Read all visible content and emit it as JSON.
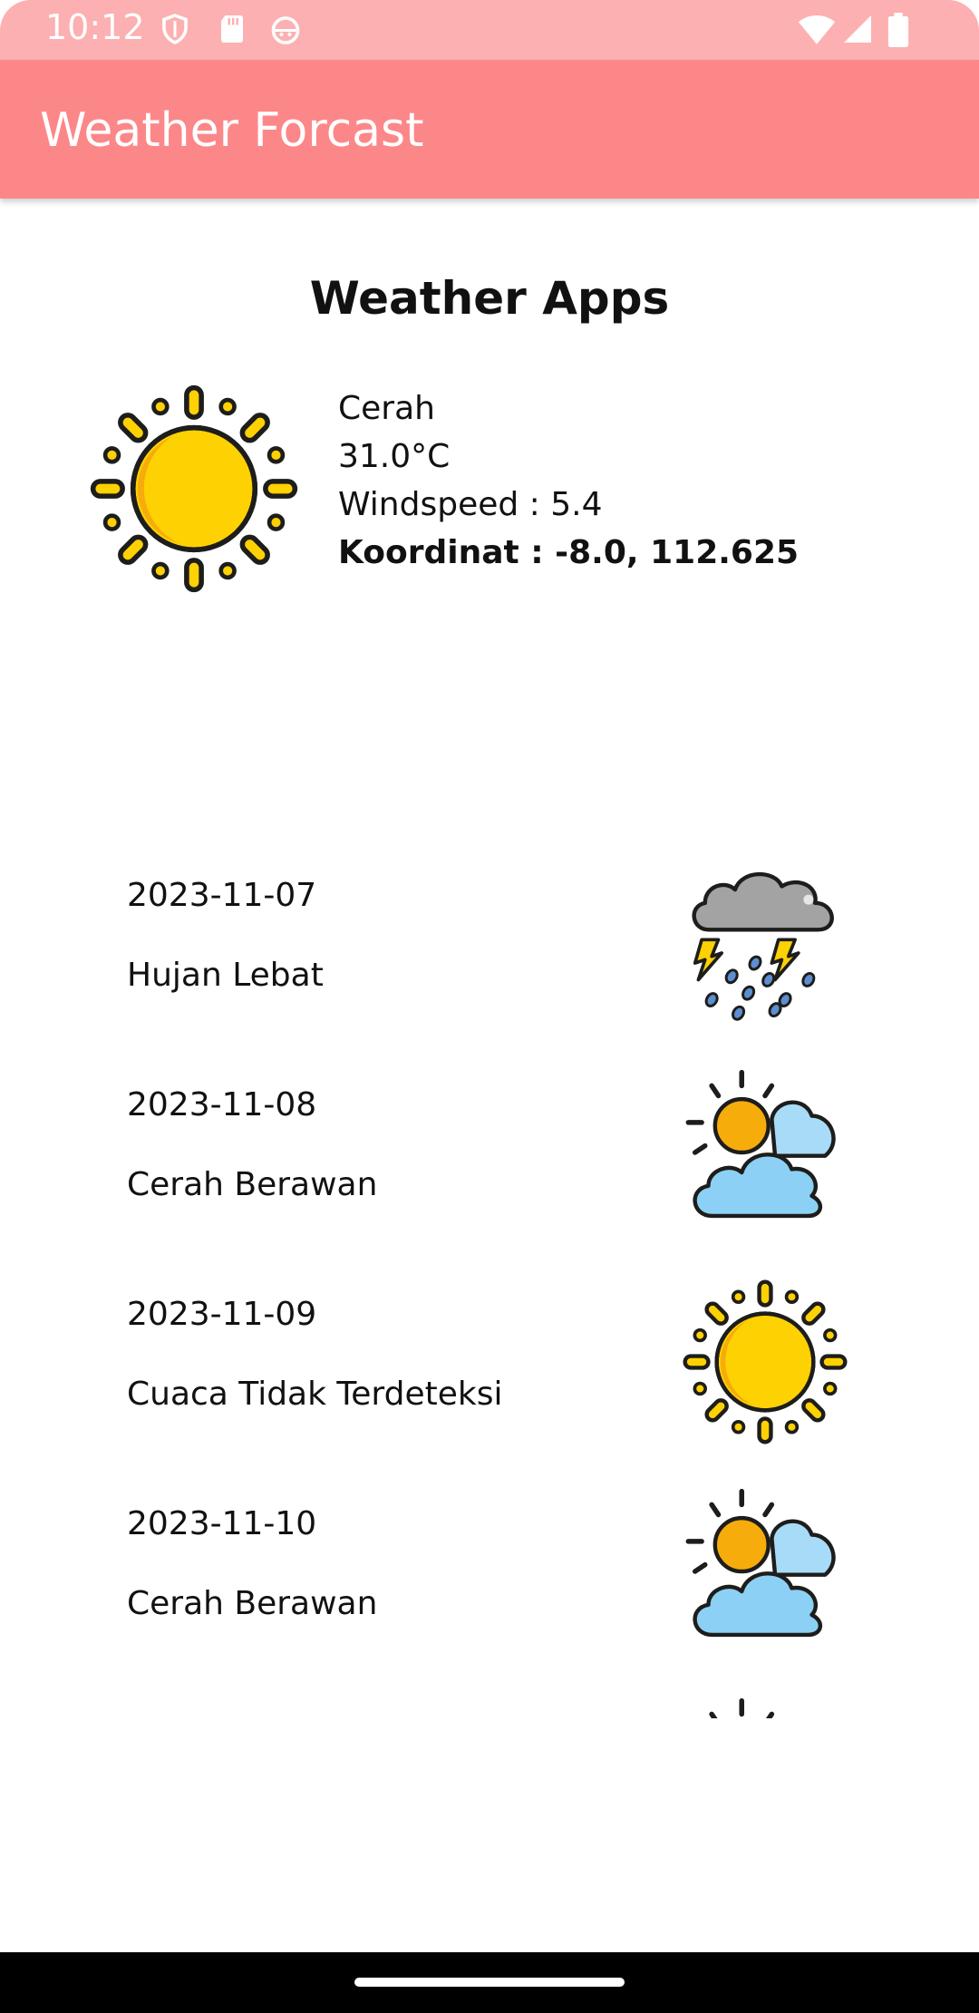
{
  "status_bar": {
    "time": "10:12",
    "icons": [
      "shield-icon",
      "sd-card-icon",
      "android-face-icon",
      "wifi-icon",
      "signal-icon",
      "battery-icon"
    ]
  },
  "app_bar": {
    "title": "Weather Forcast"
  },
  "main": {
    "heading": "Weather Apps",
    "current": {
      "icon": "sun-icon",
      "condition": "Cerah",
      "temperature": "31.0°C",
      "windspeed": "Windspeed : 5.4",
      "coordinates": "Koordinat : -8.0, 112.625"
    },
    "forecast": [
      {
        "date": "2023-11-07",
        "description": "Hujan Lebat",
        "icon": "thunderstorm-icon"
      },
      {
        "date": "2023-11-08",
        "description": "Cerah Berawan",
        "icon": "partly-cloudy-icon"
      },
      {
        "date": "2023-11-09",
        "description": "Cuaca Tidak Terdeteksi",
        "icon": "sun-icon"
      },
      {
        "date": "2023-11-10",
        "description": "Cerah Berawan",
        "icon": "partly-cloudy-icon"
      },
      {
        "date": "",
        "description": "",
        "icon": "partly-cloudy-icon"
      }
    ]
  },
  "colors": {
    "status_bar": "#fcb0b1",
    "app_bar": "#fc8789",
    "sun": "#fed103",
    "sun_orange": "#f6ac0a",
    "cloud_blue": "#8dd0f5",
    "cloud_grey": "#a3a3a3",
    "lightning": "#fed103",
    "rain": "#5d8fd0"
  }
}
